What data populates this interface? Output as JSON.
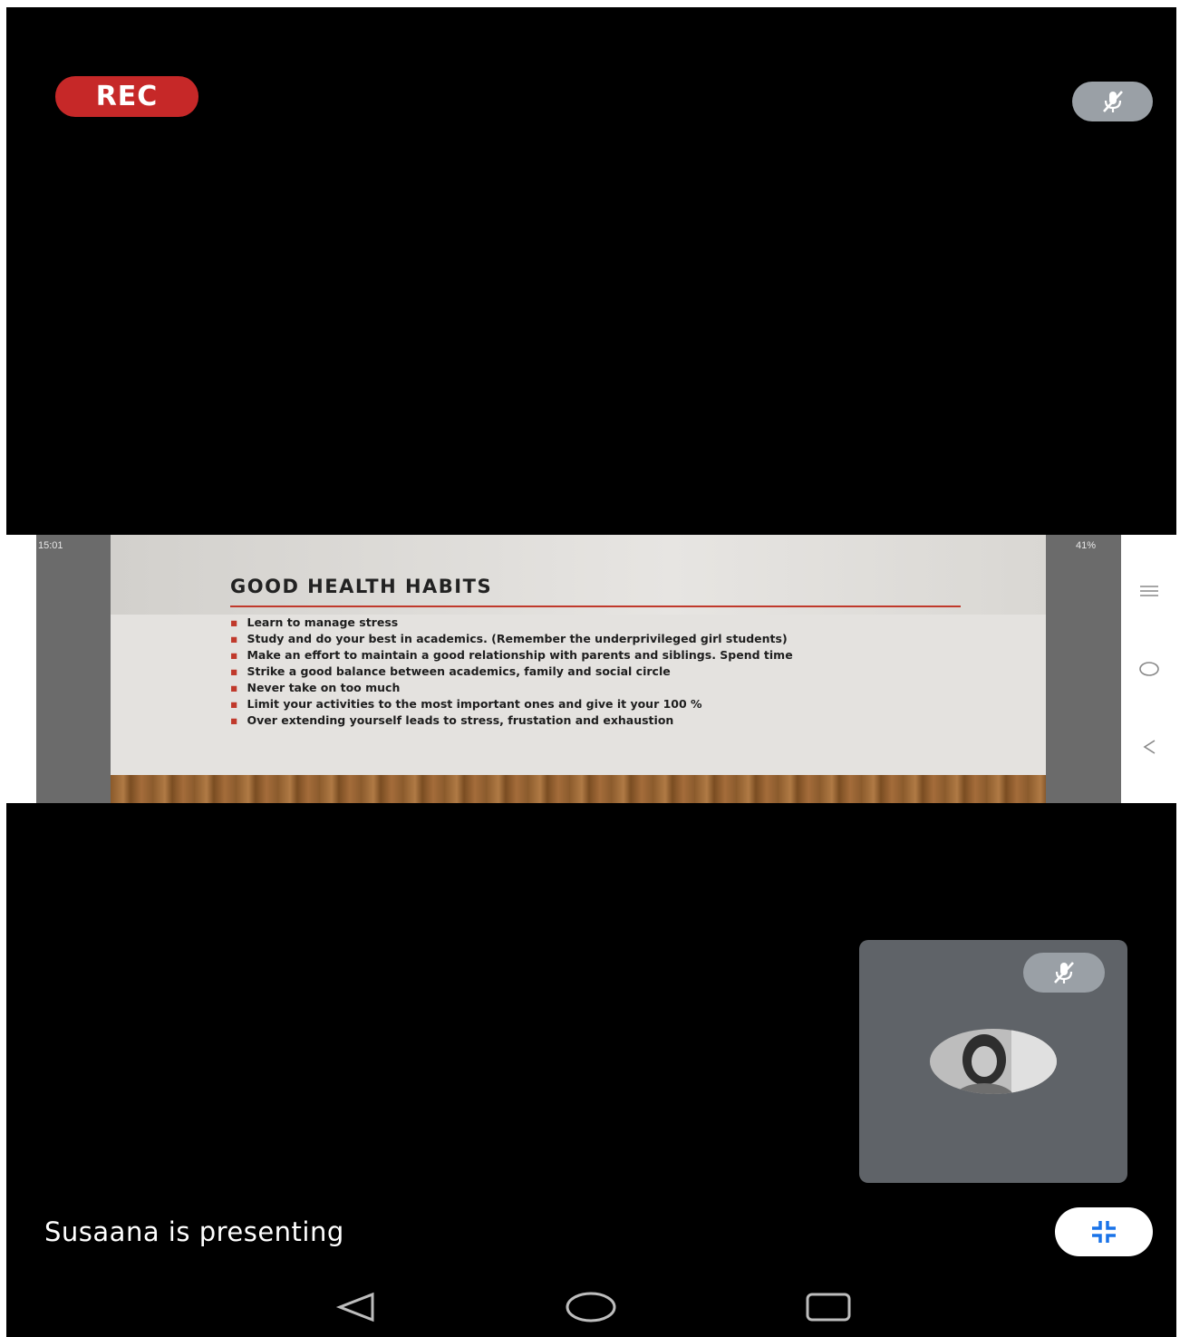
{
  "call": {
    "rec_label": "REC",
    "presenting_text": "Susaana is presenting"
  },
  "shared_screen": {
    "phone_time": "15:01",
    "phone_battery": "41%",
    "slide": {
      "title": "GOOD HEALTH HABITS",
      "bullets": [
        "Learn to manage stress",
        "Study and do your best in academics. (Remember the underprivileged girl students)",
        "Make an effort to maintain a good relationship with parents and siblings. Spend time",
        "Strike a good balance between academics, family and social circle",
        "Never take on too much",
        "Limit your activities to the most important ones and give it your 100 %",
        "Over extending yourself leads to stress, frustation and exhaustion"
      ]
    },
    "nav_icons": [
      "menu-icon",
      "home-circle-icon",
      "back-chevron-icon"
    ]
  },
  "system_nav": [
    "back-triangle-icon",
    "home-circle-icon",
    "recents-square-icon"
  ],
  "colors": {
    "background": "#000000",
    "rec_badge": "#c62828",
    "mic_badge": "#9aa0a6",
    "tile": "#5f6368",
    "accent": "#1a73e8"
  }
}
